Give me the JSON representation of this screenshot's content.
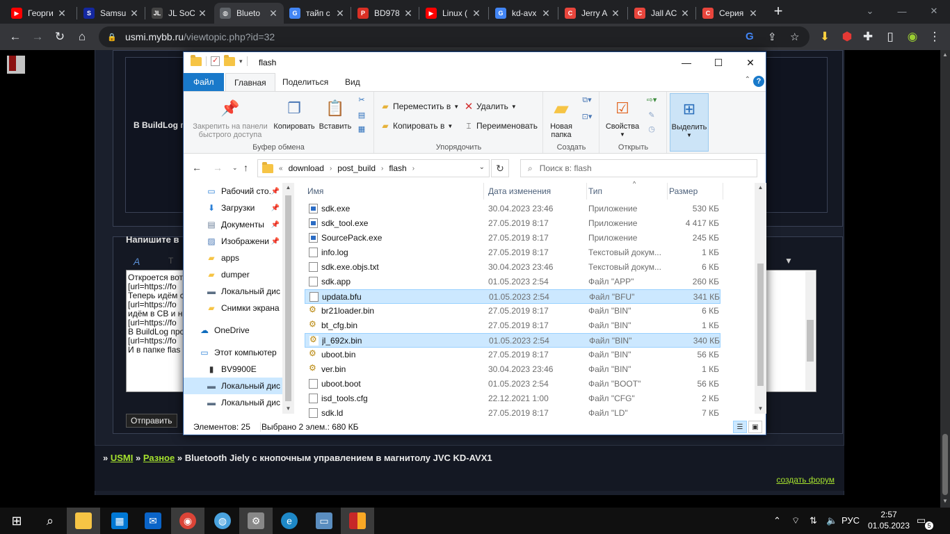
{
  "browser": {
    "tabs": [
      {
        "title": "Георги",
        "fav": "▶",
        "favcolor": "#ff0000"
      },
      {
        "title": "Samsu",
        "fav": "S",
        "favcolor": "#1428a0"
      },
      {
        "title": "JL SoC",
        "fav": "JL",
        "favcolor": "#444444"
      },
      {
        "title": "Blueto",
        "fav": "◍",
        "favcolor": "#5f6368"
      },
      {
        "title": "тайп с",
        "fav": "G",
        "favcolor": "#4285f4"
      },
      {
        "title": "BD978",
        "fav": "P",
        "favcolor": "#d93025"
      },
      {
        "title": "Linux (",
        "fav": "▶",
        "favcolor": "#ff0000"
      },
      {
        "title": "kd-avx",
        "fav": "G",
        "favcolor": "#4285f4"
      },
      {
        "title": "Jerry A",
        "fav": "C",
        "favcolor": "#e8453c"
      },
      {
        "title": "Jall AC",
        "fav": "C",
        "favcolor": "#e8453c"
      },
      {
        "title": "Серия",
        "fav": "C",
        "favcolor": "#e8453c"
      }
    ],
    "new_tab": "+",
    "url_host": "usmi.mybb.ru",
    "url_path": "/viewtopic.php?id=32"
  },
  "page": {
    "post_line": "В BuildLog пр",
    "reply_title": "Напишите в",
    "reply_lines": [
      "Откроется вот",
      "[url=https://fo",
      "Теперь идём с",
      "[url=https://fo",
      "идём в СВ и н",
      "[url=https://fo",
      "В BuildLog про",
      "[url=https://fo",
      "И в папке flas"
    ],
    "send_button": "Отправить",
    "crumb_sep": "»",
    "crumb_link1": "USMI",
    "crumb_link2": "Разное",
    "crumb_title": "Bluetooth Jiely с кнопочным управлением в магнитолу JVC KD-AVX1",
    "create_forum": "создать форум"
  },
  "explorer": {
    "title": "flash",
    "tabs": {
      "file": "Файл",
      "home": "Главная",
      "share": "Поделиться",
      "view": "Вид"
    },
    "ribbon": {
      "pin": "Закрепить на панели быстрого доступа",
      "copy": "Копировать",
      "paste": "Вставить",
      "group_clipboard": "Буфер обмена",
      "move_to": "Переместить в",
      "copy_to": "Копировать в",
      "delete": "Удалить",
      "rename": "Переименовать",
      "group_organize": "Упорядочить",
      "new_folder": "Новая папка",
      "group_new": "Создать",
      "properties": "Свойства",
      "group_open": "Открыть",
      "select": "Выделить"
    },
    "address": {
      "prefix": "«",
      "parts": [
        "download",
        "post_build",
        "flash"
      ]
    },
    "search_placeholder": "Поиск в: flash",
    "nav": [
      {
        "label": "Рабочий сто.",
        "icon": "desktop-icon",
        "pin": true
      },
      {
        "label": "Загрузки",
        "icon": "download-icon",
        "pin": true
      },
      {
        "label": "Документы",
        "icon": "documents-icon",
        "pin": true
      },
      {
        "label": "Изображени",
        "icon": "pictures-icon",
        "pin": true
      },
      {
        "label": "apps",
        "icon": "folder-icon",
        "pin": false
      },
      {
        "label": "dumper",
        "icon": "folder-icon",
        "pin": false
      },
      {
        "label": "Локальный дис",
        "icon": "drive-icon",
        "pin": false
      },
      {
        "label": "Снимки экрана",
        "icon": "folder-icon",
        "pin": false
      },
      {
        "label": "OneDrive",
        "icon": "cloud-icon",
        "pin": false
      },
      {
        "label": "Этот компьютер",
        "icon": "computer-icon",
        "pin": false
      },
      {
        "label": "BV9900E",
        "icon": "phone-icon",
        "pin": false
      },
      {
        "label": "Локальный дис",
        "icon": "drive-icon",
        "pin": false
      },
      {
        "label": "Локальный дис",
        "icon": "drive-icon",
        "pin": false
      }
    ],
    "columns": {
      "name": "Имя",
      "date": "Дата изменения",
      "type": "Тип",
      "size": "Размер"
    },
    "files": [
      {
        "name": "sdk.exe",
        "date": "30.04.2023 23:46",
        "type": "Приложение",
        "size": "530 КБ",
        "kind": "exe"
      },
      {
        "name": "sdk_tool.exe",
        "date": "27.05.2019 8:17",
        "type": "Приложение",
        "size": "4 417 КБ",
        "kind": "exe"
      },
      {
        "name": "SourcePack.exe",
        "date": "27.05.2019 8:17",
        "type": "Приложение",
        "size": "245 КБ",
        "kind": "exe"
      },
      {
        "name": "info.log",
        "date": "27.05.2019 8:17",
        "type": "Текстовый докум...",
        "size": "1 КБ",
        "kind": "txt"
      },
      {
        "name": "sdk.exe.objs.txt",
        "date": "30.04.2023 23:46",
        "type": "Текстовый докум...",
        "size": "6 КБ",
        "kind": "txt"
      },
      {
        "name": "sdk.app",
        "date": "01.05.2023 2:54",
        "type": "Файл \"APP\"",
        "size": "260 КБ",
        "kind": "file"
      },
      {
        "name": "updata.bfu",
        "date": "01.05.2023 2:54",
        "type": "Файл \"BFU\"",
        "size": "341 КБ",
        "kind": "file",
        "selected": true
      },
      {
        "name": "br21loader.bin",
        "date": "27.05.2019 8:17",
        "type": "Файл \"BIN\"",
        "size": "6 КБ",
        "kind": "bin"
      },
      {
        "name": "bt_cfg.bin",
        "date": "27.05.2019 8:17",
        "type": "Файл \"BIN\"",
        "size": "1 КБ",
        "kind": "bin"
      },
      {
        "name": "jl_692x.bin",
        "date": "01.05.2023 2:54",
        "type": "Файл \"BIN\"",
        "size": "340 КБ",
        "kind": "bin",
        "selected": true
      },
      {
        "name": "uboot.bin",
        "date": "27.05.2019 8:17",
        "type": "Файл \"BIN\"",
        "size": "56 КБ",
        "kind": "bin"
      },
      {
        "name": "ver.bin",
        "date": "30.04.2023 23:46",
        "type": "Файл \"BIN\"",
        "size": "1 КБ",
        "kind": "bin"
      },
      {
        "name": "uboot.boot",
        "date": "01.05.2023 2:54",
        "type": "Файл \"BOOT\"",
        "size": "56 КБ",
        "kind": "file"
      },
      {
        "name": "isd_tools.cfg",
        "date": "22.12.2021 1:00",
        "type": "Файл \"CFG\"",
        "size": "2 КБ",
        "kind": "file"
      },
      {
        "name": "sdk.ld",
        "date": "27.05.2019 8:17",
        "type": "Файл \"LD\"",
        "size": "7 КБ",
        "kind": "file"
      }
    ],
    "status_count": "Элементов: 25",
    "status_selected": "Выбрано 2 элем.: 680 КБ"
  },
  "taskbar": {
    "lang": "РУС",
    "time": "2:57",
    "date": "01.05.2023",
    "notif_count": "5"
  }
}
